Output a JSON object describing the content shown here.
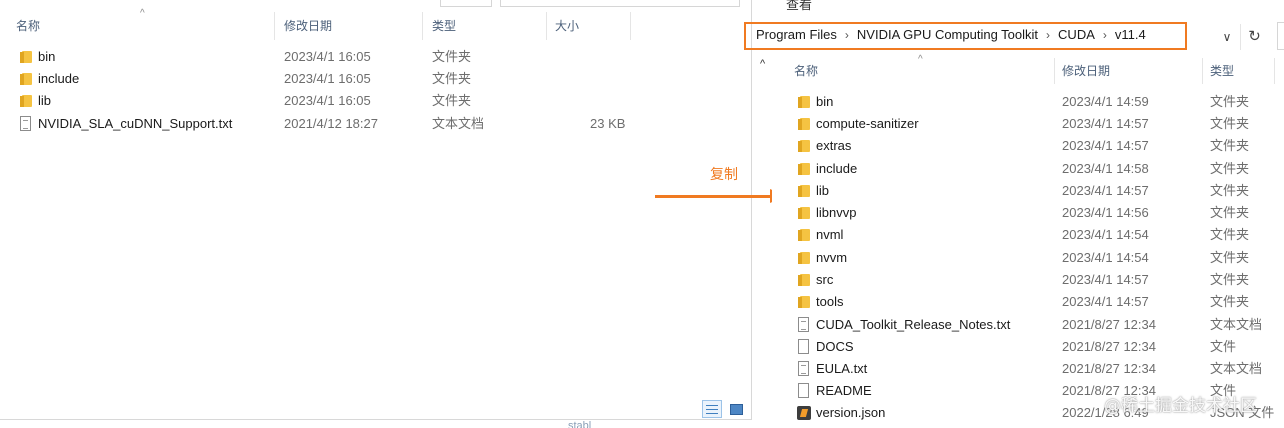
{
  "annotation": {
    "copy_label": "复制"
  },
  "left_window": {
    "columns": {
      "name": "名称",
      "modified": "修改日期",
      "type": "类型",
      "size": "大小"
    },
    "items": [
      {
        "name": "bin",
        "modified": "2023/4/1 16:05",
        "type": "文件夹",
        "size": "",
        "icon": "folder"
      },
      {
        "name": "include",
        "modified": "2023/4/1 16:05",
        "type": "文件夹",
        "size": "",
        "icon": "folder"
      },
      {
        "name": "lib",
        "modified": "2023/4/1 16:05",
        "type": "文件夹",
        "size": "",
        "icon": "folder"
      },
      {
        "name": "NVIDIA_SLA_cuDNN_Support.txt",
        "modified": "2021/4/12 18:27",
        "type": "文本文档",
        "size": "23 KB",
        "icon": "text-file"
      }
    ]
  },
  "right_window": {
    "ribbon_tab": "查看",
    "breadcrumb": [
      "Program Files",
      "NVIDIA GPU Computing Toolkit",
      "CUDA",
      "v11.4"
    ],
    "columns": {
      "name": "名称",
      "modified": "修改日期",
      "type": "类型"
    },
    "items": [
      {
        "name": "bin",
        "modified": "2023/4/1 14:59",
        "type": "文件夹",
        "icon": "folder"
      },
      {
        "name": "compute-sanitizer",
        "modified": "2023/4/1 14:57",
        "type": "文件夹",
        "icon": "folder"
      },
      {
        "name": "extras",
        "modified": "2023/4/1 14:57",
        "type": "文件夹",
        "icon": "folder"
      },
      {
        "name": "include",
        "modified": "2023/4/1 14:58",
        "type": "文件夹",
        "icon": "folder"
      },
      {
        "name": "lib",
        "modified": "2023/4/1 14:57",
        "type": "文件夹",
        "icon": "folder"
      },
      {
        "name": "libnvvp",
        "modified": "2023/4/1 14:56",
        "type": "文件夹",
        "icon": "folder"
      },
      {
        "name": "nvml",
        "modified": "2023/4/1 14:54",
        "type": "文件夹",
        "icon": "folder"
      },
      {
        "name": "nvvm",
        "modified": "2023/4/1 14:54",
        "type": "文件夹",
        "icon": "folder"
      },
      {
        "name": "src",
        "modified": "2023/4/1 14:57",
        "type": "文件夹",
        "icon": "folder"
      },
      {
        "name": "tools",
        "modified": "2023/4/1 14:57",
        "type": "文件夹",
        "icon": "folder"
      },
      {
        "name": "CUDA_Toolkit_Release_Notes.txt",
        "modified": "2021/8/27 12:34",
        "type": "文本文档",
        "icon": "text-file"
      },
      {
        "name": "DOCS",
        "modified": "2021/8/27 12:34",
        "type": "文件",
        "icon": "blank-file"
      },
      {
        "name": "EULA.txt",
        "modified": "2021/8/27 12:34",
        "type": "文本文档",
        "icon": "text-file"
      },
      {
        "name": "README",
        "modified": "2021/8/27 12:34",
        "type": "文件",
        "icon": "blank-file"
      },
      {
        "name": "version.json",
        "modified": "2022/1/28 6:49",
        "type": "JSON 文件",
        "icon": "json-file"
      }
    ]
  },
  "watermark": "@稀土掘金技术社区",
  "background_text": "stabl"
}
